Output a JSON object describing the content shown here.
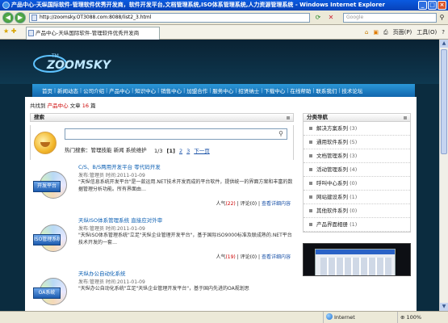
{
  "window": {
    "title": "产品中心-天纵国际软件-管理软件优秀开发商，软件开发平台,文档管理系统,ISO体系管理系统,人力资源管理系统 - Windows Internet Explorer"
  },
  "browser": {
    "url": "http://zoomsky.OT3088.com:8088/list2_3.html",
    "search_placeholder": "Google",
    "tab_title": "产品中心-天纵国际软件-管理软件优秀开发商",
    "cmd_page": "页面(P)",
    "cmd_tools": "工具(O)",
    "cmd_help": "?"
  },
  "site": {
    "logo_text": "ZOOMSKY",
    "logo_tm": "TM",
    "nav": [
      "首页",
      "新闻动态",
      "公司介绍",
      "产品中心",
      "知识中心",
      "销售中心",
      "加盟合作",
      "服务中心",
      "招贤纳士",
      "下载中心",
      "在线帮助",
      "联系我们",
      "技术论坛"
    ]
  },
  "stats": {
    "prefix": "共找到",
    "category": "产品中心",
    "middle": "文章",
    "count": "16",
    "suffix": "篇"
  },
  "search_panel": {
    "title": "搜索",
    "hot_label": "热门搜索：管理技能 新闻 系统维护"
  },
  "pager": {
    "summary": "1/3",
    "current": "[1]",
    "page2": "2",
    "page3": "3",
    "next": "下一页"
  },
  "products": [
    {
      "name": "C/S、B/S两用开发平台 零代码开发",
      "meta": "发布:管理员 时间:2011-01-09",
      "desc": "\"天纵信息系统开发平台\"是一款运用.NET技术开发而成的平台软件，提供统一的界面方案和丰富的数据管理分析功能。所有界面由…",
      "box": "开发平台",
      "views_label": "人气",
      "views": "(22)",
      "comments_label": "评论",
      "comments": "(0)",
      "detail": "查看详细内容"
    },
    {
      "name": "天纵ISO体系管理系统 直接应对外审",
      "meta": "发布:管理员 时间:2011-01-09",
      "desc": "\"天纵ISO体系管理系统\"立足\"天纵企业管理开发平台\"，基于国际ISO9000标准及联成熟的.NET平台技术开发的一套…",
      "box": "ISO管理系统",
      "views_label": "人气",
      "views": "(19)",
      "comments_label": "评论",
      "comments": "(0)",
      "detail": "查看详细内容"
    },
    {
      "name": "天纵办公自动化系统",
      "meta": "发布:管理员 时间:2011-01-09",
      "desc": "\"天纵办公自动化系统\"立足\"天纵企业管理开发平台\"，基于国内先进的OA规划思",
      "box": "OA系统",
      "views_label": "",
      "views": "",
      "comments_label": "",
      "comments": "",
      "detail": ""
    }
  ],
  "sidebar": {
    "title": "分类导航",
    "categories": [
      {
        "label": "解决方案系列",
        "count": "(3)"
      },
      {
        "label": "通用软件系列",
        "count": "(5)"
      },
      {
        "label": "文档管理系列",
        "count": "(3)"
      },
      {
        "label": "活动管理系列",
        "count": "(4)"
      },
      {
        "label": "呼叫中心系列",
        "count": "(0)"
      },
      {
        "label": "网站建设系列",
        "count": "(1)"
      },
      {
        "label": "其他软件系列",
        "count": "(0)"
      },
      {
        "label": "产品界面相册",
        "count": "(1)"
      }
    ]
  },
  "status": {
    "zone": "Internet",
    "zoom": "100%"
  },
  "colors": {
    "ie_title": "#0a5ae0",
    "nav_bar": "#1f7fc4",
    "header_bg": "#0b2c3f",
    "highlight": "#cc0000",
    "link": "#1a52a8"
  }
}
